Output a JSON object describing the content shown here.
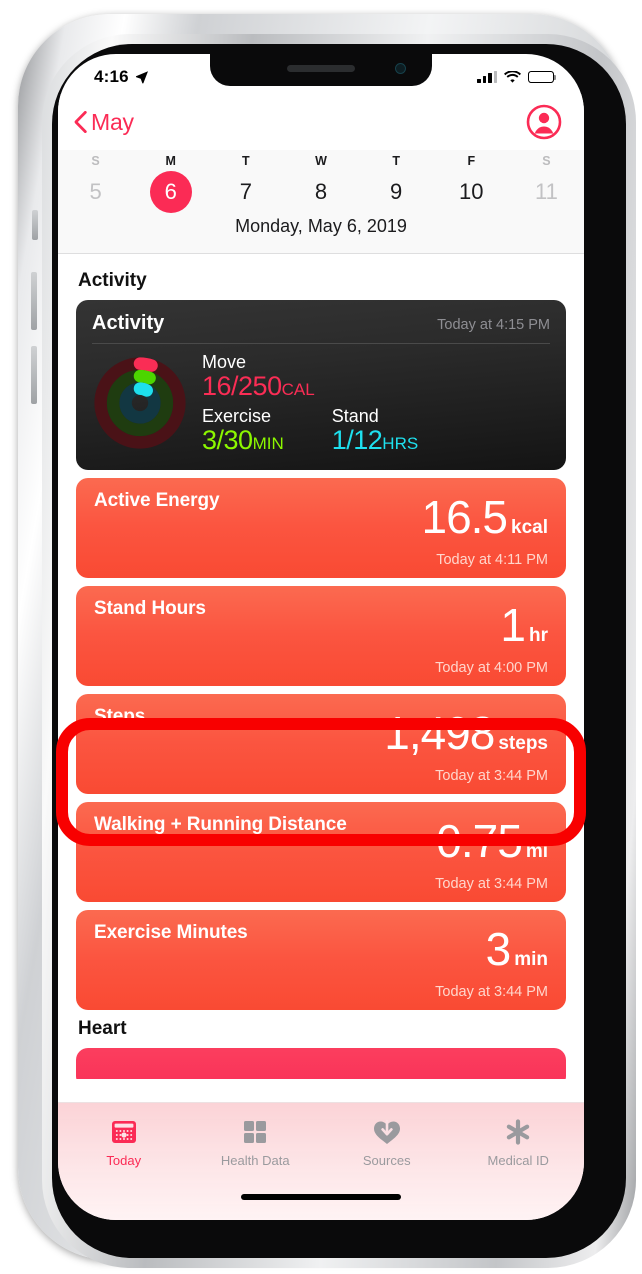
{
  "status_bar": {
    "time": "4:16",
    "location_icon": "location-arrow-icon",
    "cellular_icon": "cellular-bars-icon",
    "wifi_icon": "wifi-icon",
    "battery_icon": "battery-icon"
  },
  "nav": {
    "back_label": "May",
    "back_icon": "chevron-left-icon",
    "profile_icon": "profile-person-icon",
    "accent_color": "#fb2b55"
  },
  "week_strip": {
    "day_initials": [
      "S",
      "M",
      "T",
      "W",
      "T",
      "F",
      "S"
    ],
    "dates": [
      "5",
      "6",
      "7",
      "8",
      "9",
      "10",
      "11"
    ],
    "selected_index": 1,
    "dimmed_indices": [
      0,
      6
    ],
    "full_date": "Monday, May 6, 2019"
  },
  "sections": [
    {
      "title": "Activity"
    },
    {
      "title": "Heart"
    }
  ],
  "activity_card": {
    "title": "Activity",
    "timestamp": "Today at 4:15 PM",
    "rings_icon": "activity-rings-icon",
    "metrics": [
      {
        "label": "Move",
        "value": "16/250",
        "unit": "CAL",
        "color": "#fa2d55"
      },
      {
        "label": "Exercise",
        "value": "3/30",
        "unit": "MIN",
        "color": "#8cf700"
      },
      {
        "label": "Stand",
        "value": "1/12",
        "unit": "HRS",
        "color": "#1ee0ee"
      }
    ]
  },
  "metric_cards": [
    {
      "title": "Active Energy",
      "value": "16.5",
      "unit": "kcal",
      "timestamp": "Today at 4:11 PM"
    },
    {
      "title": "Stand Hours",
      "value": "1",
      "unit": "hr",
      "timestamp": "Today at 4:00 PM"
    },
    {
      "title": "Steps",
      "value": "1,498",
      "unit": "steps",
      "timestamp": "Today at 3:44 PM",
      "highlighted": true
    },
    {
      "title": "Walking + Running Distance",
      "value": "0.75",
      "unit": "mi",
      "timestamp": "Today at 3:44 PM"
    },
    {
      "title": "Exercise Minutes",
      "value": "3",
      "unit": "min",
      "timestamp": "Today at 3:44 PM"
    }
  ],
  "tab_bar": {
    "tabs": [
      {
        "label": "Today",
        "icon": "calendar-icon",
        "active": true
      },
      {
        "label": "Health Data",
        "icon": "grid-squares-icon",
        "active": false
      },
      {
        "label": "Sources",
        "icon": "heart-download-icon",
        "active": false
      },
      {
        "label": "Medical ID",
        "icon": "medical-asterisk-icon",
        "active": false
      }
    ]
  },
  "annotation": {
    "shape": "rounded-rectangle",
    "color": "#f80000",
    "targets": "Steps"
  }
}
